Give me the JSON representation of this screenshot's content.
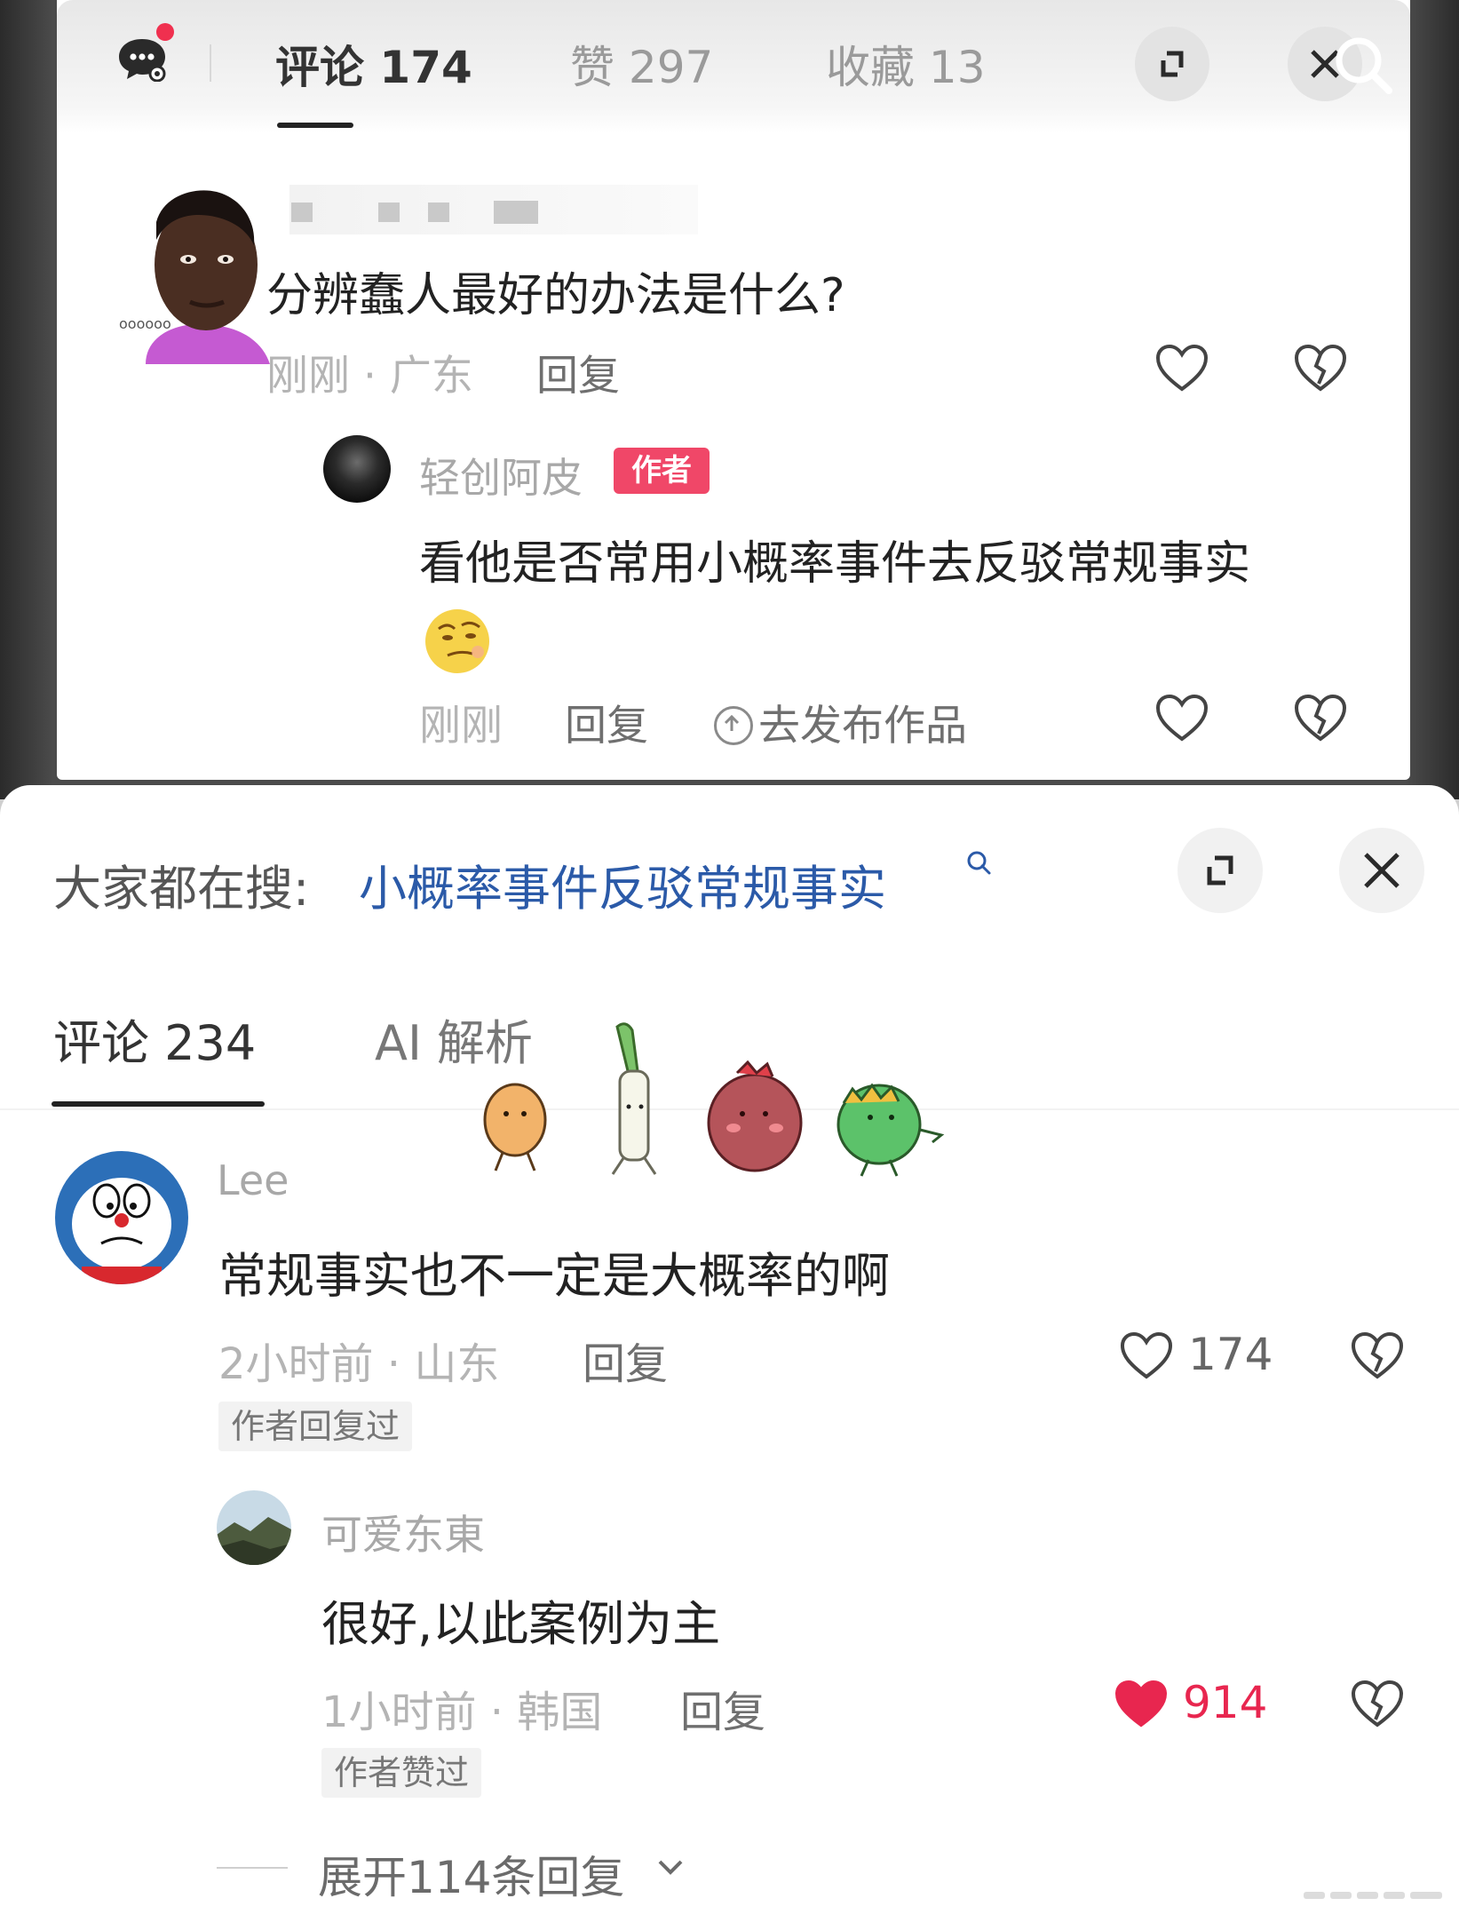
{
  "top_panel": {
    "tabs": [
      {
        "label": "评论 174",
        "active": true
      },
      {
        "label": "赞 297",
        "active": false
      },
      {
        "label": "收藏 13",
        "active": false
      }
    ],
    "comment": {
      "text": "分辨蠢人最好的办法是什么?",
      "meta": "刚刚 · 广东",
      "reply_label": "回复"
    },
    "reply": {
      "username": "轻创阿皮",
      "badge": "作者",
      "text": "看他是否常用小概率事件去反驳常规事实",
      "meta": "刚刚",
      "reply_label": "回复",
      "publish_label": "去发布作品"
    },
    "icons": [
      "message-icon",
      "expand-icon",
      "close-icon",
      "search-icon",
      "heart-icon",
      "dislike-icon"
    ]
  },
  "bottom_panel": {
    "search": {
      "label": "大家都在搜:",
      "term": "小概率事件反驳常规事实"
    },
    "tabs": [
      {
        "label": "评论 234",
        "active": true
      },
      {
        "label": "AI 解析",
        "active": false
      }
    ],
    "comments": [
      {
        "username": "Lee",
        "text": "常规事实也不一定是大概率的啊",
        "meta": "2小时前 · 山东",
        "reply_label": "回复",
        "likes": "174",
        "liked": false,
        "tag": "作者回复过"
      }
    ],
    "replies": [
      {
        "username": "可爱东東",
        "text": "很好,以此案例为主",
        "meta": "1小时前 · 韩国",
        "reply_label": "回复",
        "likes": "914",
        "liked": true,
        "tag": "作者赞过"
      }
    ],
    "expand_label": "展开114条回复",
    "colors": {
      "accent_link": "#2b5aa8",
      "like_red": "#e8264f",
      "author_badge": "#f04768"
    }
  }
}
